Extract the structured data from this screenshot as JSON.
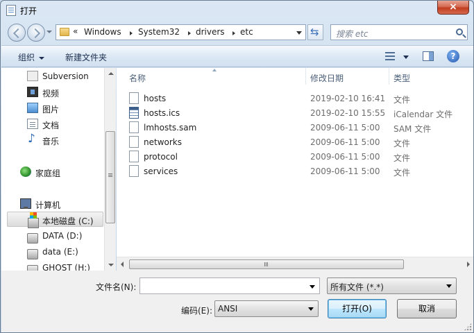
{
  "window": {
    "title": "打开",
    "close_glyph": "×"
  },
  "address": {
    "chevron": "«",
    "crumbs": [
      "Windows",
      "System32",
      "drivers",
      "etc"
    ]
  },
  "search": {
    "placeholder": "搜索 etc"
  },
  "toolbar": {
    "organize": "组织",
    "new_folder": "新建文件夹",
    "help": "?"
  },
  "nav": {
    "items": [
      {
        "label": "Subversion",
        "icon": "subversion-icon"
      },
      {
        "label": "视频",
        "icon": "video-library-icon"
      },
      {
        "label": "图片",
        "icon": "pictures-library-icon"
      },
      {
        "label": "文档",
        "icon": "documents-library-icon"
      },
      {
        "label": "音乐",
        "icon": "music-library-icon"
      },
      {
        "label": "家庭组",
        "icon": "homegroup-icon"
      },
      {
        "label": "计算机",
        "icon": "computer-icon"
      },
      {
        "label": "本地磁盘 (C:)",
        "icon": "local-disk-icon"
      },
      {
        "label": "DATA (D:)",
        "icon": "drive-icon"
      },
      {
        "label": "data (E:)",
        "icon": "drive-icon"
      },
      {
        "label": "GHOST (H:)",
        "icon": "drive-icon"
      }
    ]
  },
  "columns": {
    "name": "名称",
    "date": "修改日期",
    "type": "类型"
  },
  "files": [
    {
      "name": "hosts",
      "date": "2019-02-10 16:41",
      "type": "文件",
      "icon": "file-icon"
    },
    {
      "name": "hosts.ics",
      "date": "2019-02-10 15:55",
      "type": "iCalendar 文件",
      "icon": "calendar-file-icon"
    },
    {
      "name": "lmhosts.sam",
      "date": "2009-06-11 5:00",
      "type": "SAM 文件",
      "icon": "file-icon"
    },
    {
      "name": "networks",
      "date": "2009-06-11 5:00",
      "type": "文件",
      "icon": "file-icon"
    },
    {
      "name": "protocol",
      "date": "2009-06-11 5:00",
      "type": "文件",
      "icon": "file-icon"
    },
    {
      "name": "services",
      "date": "2009-06-11 5:00",
      "type": "文件",
      "icon": "file-icon"
    }
  ],
  "bottom": {
    "filename_label": "文件名(N):",
    "filename_value": "",
    "filter_value": "所有文件  (*.*)",
    "encoding_label": "编码(E):",
    "encoding_value": "ANSI",
    "open_button": "打开(O)",
    "cancel_button": "取消"
  }
}
